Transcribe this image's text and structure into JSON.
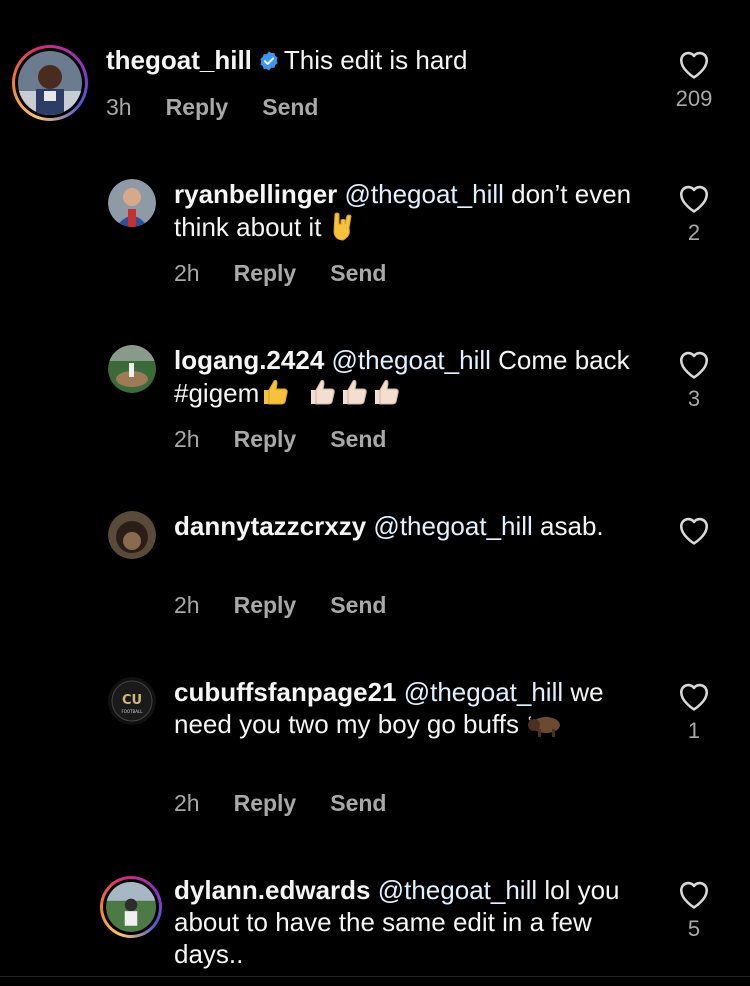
{
  "comments": [
    {
      "username": "thegoat_hill",
      "verified": true,
      "text": "This edit is hard",
      "time": "3h",
      "reply": "Reply",
      "send": "Send",
      "likes": "209",
      "story_ring": true
    },
    {
      "username": "ryanbellinger",
      "mention": "@thegoat_hill",
      "text": "don’t even think about it",
      "time": "2h",
      "reply": "Reply",
      "send": "Send",
      "likes": "2",
      "emojis": [
        "rock-on-hand-emoji"
      ]
    },
    {
      "username": "logang.2424",
      "mention": "@thegoat_hill",
      "text": "Come back #gigem",
      "time": "2h",
      "reply": "Reply",
      "send": "Send",
      "likes": "3",
      "emojis": [
        "thumbs-up-emoji",
        "thumbs-up-light-emoji",
        "thumbs-up-light-emoji",
        "thumbs-up-light-emoji"
      ]
    },
    {
      "username": "dannytazzcrxzy",
      "mention": "@thegoat_hill",
      "text": "asab.",
      "time": "2h",
      "reply": "Reply",
      "send": "Send",
      "likes": ""
    },
    {
      "username": "cubuffsfanpage21",
      "mention": "@thegoat_hill",
      "text": "we need you two my boy go buffs",
      "time": "2h",
      "reply": "Reply",
      "send": "Send",
      "likes": "1",
      "emojis": [
        "bison-emoji"
      ]
    },
    {
      "username": "dylann.edwards",
      "mention": "@thegoat_hill",
      "text": "lol you about to have the same edit in a few days..",
      "likes": "5",
      "story_ring": true
    }
  ],
  "colors": {
    "background": "#000000",
    "text": "#f5f5f5",
    "secondary": "#a8a8a8",
    "verified": "#3897f0"
  }
}
